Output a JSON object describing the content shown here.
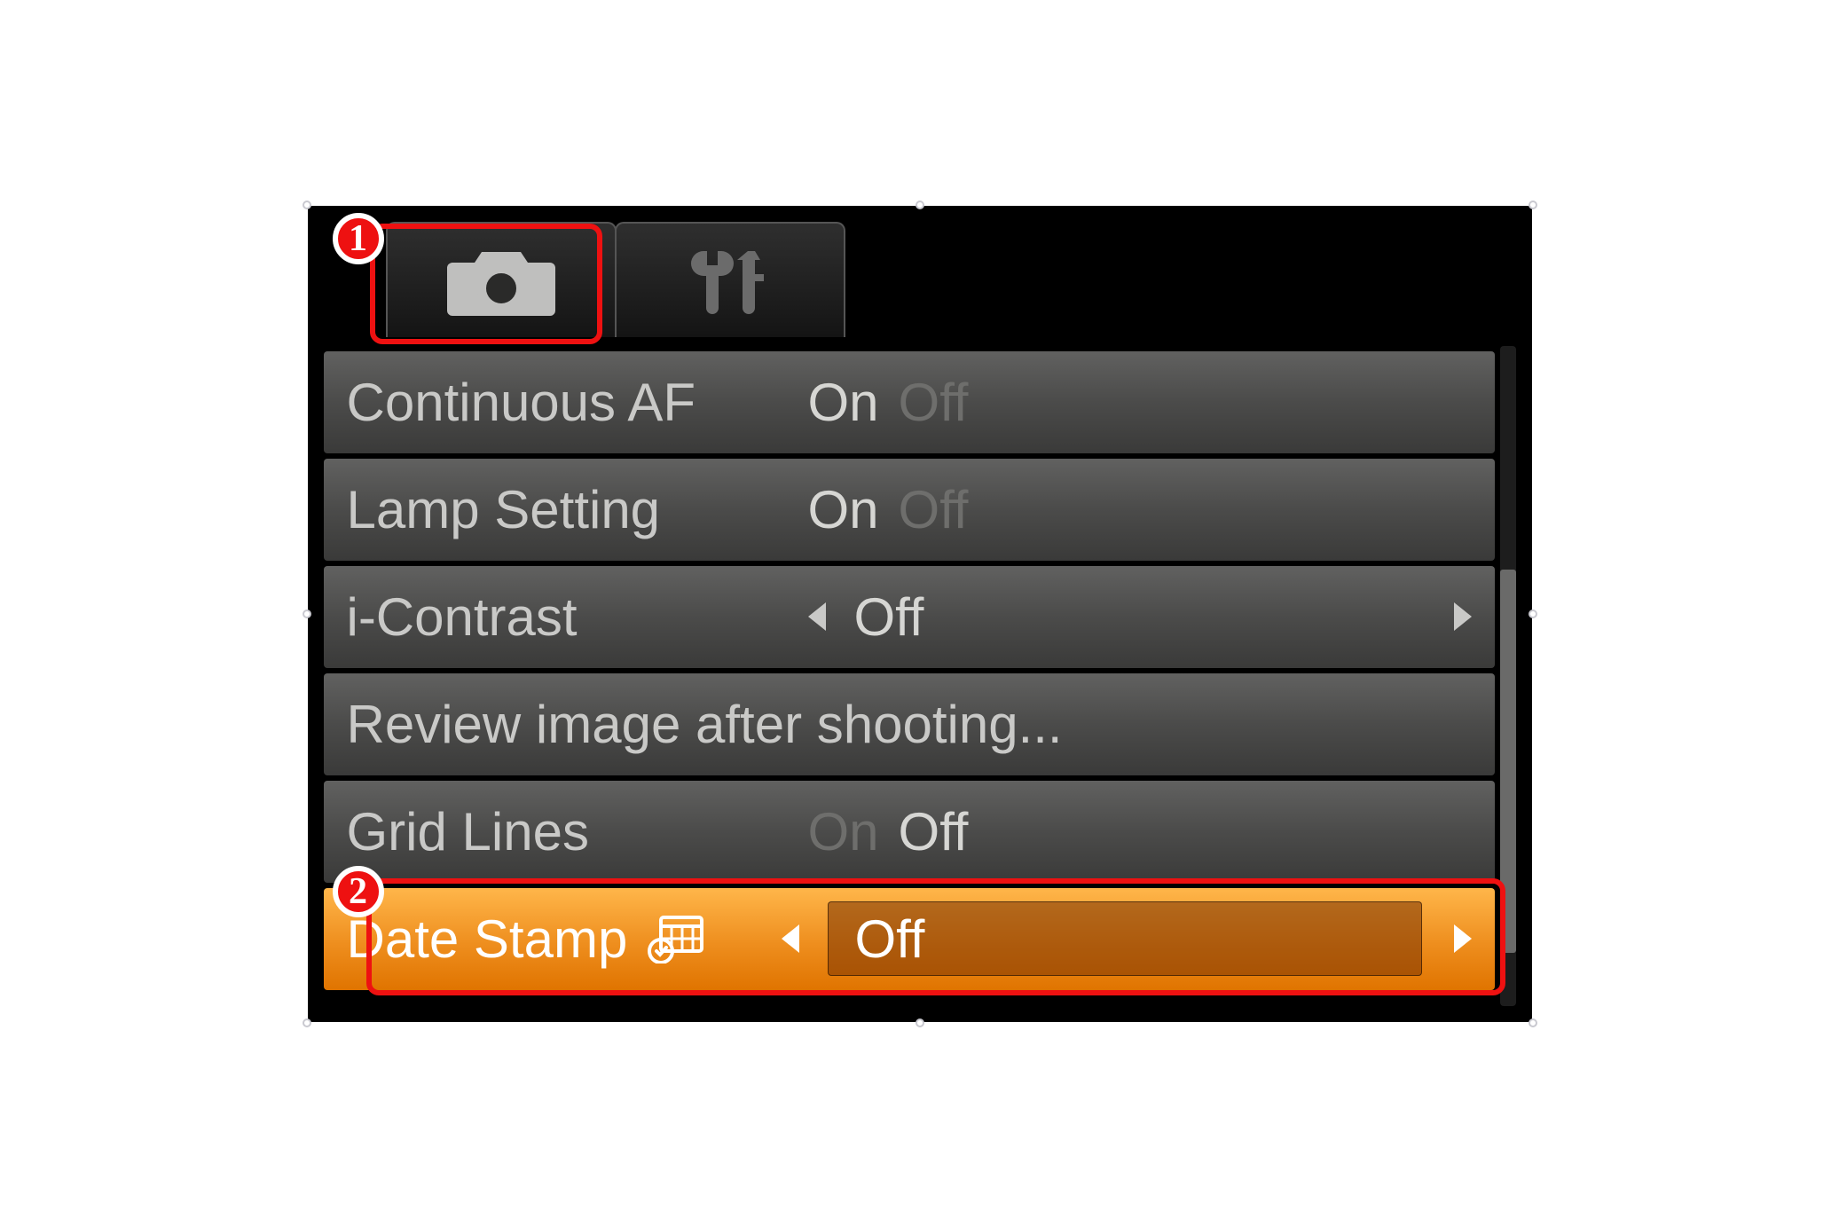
{
  "callouts": {
    "one": "1",
    "two": "2"
  },
  "tabs": {
    "shooting_icon": "camera-icon",
    "setup_icon": "tools-icon"
  },
  "menu": {
    "rows": [
      {
        "label": "Continuous AF",
        "on": "On",
        "off": "Off",
        "active": "on"
      },
      {
        "label": "Lamp Setting",
        "on": "On",
        "off": "Off",
        "active": "on"
      },
      {
        "label": "i-Contrast",
        "value": "Off",
        "arrows": true
      },
      {
        "label": "Review image after shooting..."
      },
      {
        "label": "Grid Lines",
        "on": "On",
        "off": "Off",
        "active": "off"
      },
      {
        "label": "Date Stamp",
        "value": "Off",
        "arrows": true,
        "highlight": true,
        "icon": "datestamp-icon"
      }
    ]
  },
  "colors": {
    "highlight": "#ee8e1e",
    "callout": "#e11"
  }
}
